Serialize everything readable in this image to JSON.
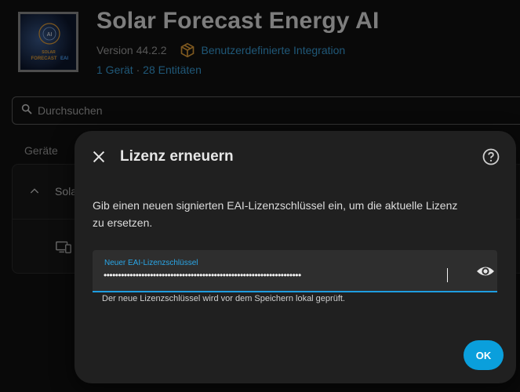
{
  "integration": {
    "title": "Solar Forecast Energy AI",
    "version": "Version 44.2.2",
    "type_label": "Benutzerdefinierte Integration",
    "device_count": "1 Gerät",
    "separator": "·",
    "entity_count": "28 Entitäten",
    "logo": {
      "line1": "SOLAR",
      "line2": "FORECAST",
      "line3": "EAI",
      "badge": "AI"
    }
  },
  "search": {
    "placeholder": "Durchsuchen"
  },
  "devices": {
    "section_label": "Geräte",
    "entry_label": "Sola"
  },
  "dialog": {
    "title": "Lizenz erneuern",
    "description": "Gib einen neuen signierten EAI-Lizenzschlüssel ein, um die aktuelle Lizenz zu ersetzen.",
    "field_label": "Neuer EAI-Lizenzschlüssel",
    "field_value": "••••••••••••••••••••••••••••••••••••••••••••••••••••••••••••••••••••",
    "hint": "Der neue Lizenzschlüssel wird vor dem Speichern lokal geprüft.",
    "ok_label": "OK"
  },
  "icons": {
    "close": "close-icon",
    "help": "help-circle-icon",
    "visibility": "eye-icon",
    "search": "search-icon",
    "package": "package-icon",
    "chevron": "chevron-up-icon",
    "devices": "devices-icon"
  },
  "colors": {
    "accent": "#0a9fdc",
    "link": "#3a9fd9",
    "package": "#e8a23a",
    "dialog_bg": "#202020"
  }
}
